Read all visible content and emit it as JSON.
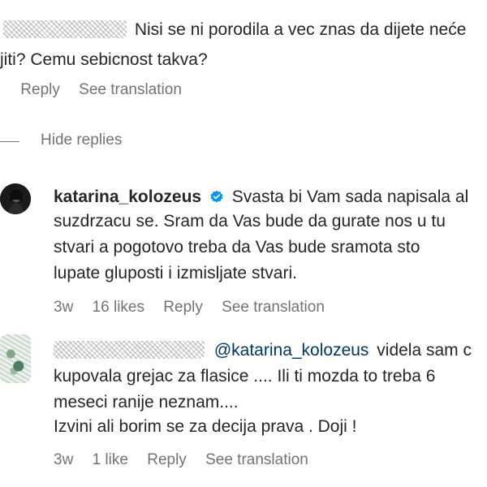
{
  "top_comment": {
    "line1": "Nisi se ni porodila a vec znas da dijete neće",
    "line2": "jiti? Cemu sebicnost takva?",
    "reply": "Reply",
    "see_translation": "See translation"
  },
  "hide_replies": "Hide replies",
  "reply1": {
    "username": "katarina_kolozeus",
    "verified_icon": "verified-badge-icon",
    "line1": "Svasta bi Vam sada napisala al",
    "line2": "suzdrzacu se. Sram da Vas bude da gurate nos u tu",
    "line3": "stvari a pogotovo treba da Vas bude sramota sto",
    "line4": "lupate gluposti i izmisljate stvari.",
    "time": "3w",
    "likes": "16 likes",
    "reply": "Reply",
    "see_translation": "See translation"
  },
  "reply2": {
    "mention": "@katarina_kolozeus",
    "line1_rest": "videla sam c",
    "line2": "kupovala grejac za flasice .... Ili ti mozda to treba 6",
    "line3": "meseci ranije neznam....",
    "line4": "Izvini ali borim se za decija prava . Doji !",
    "time": "3w",
    "likes": "1 like",
    "reply": "Reply",
    "see_translation": "See translation"
  },
  "colors": {
    "text": "#262626",
    "secondary": "#737373",
    "verified": "#0095f6",
    "mention": "#00376b"
  }
}
